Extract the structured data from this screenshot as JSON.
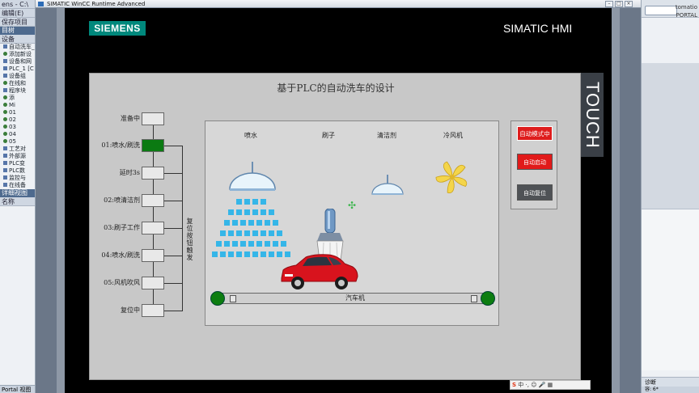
{
  "tia_left": {
    "strip1": "ens - C:\\",
    "strip2": "编辑(E)",
    "toolbar": "保存项目",
    "bar": "目树",
    "header": "设备",
    "tree": [
      "自动洗车_201",
      "添加新设",
      "设备和网",
      "PLC_1 [C",
      "设备组",
      "在线和",
      "程序块",
      "添",
      "Mi",
      "01",
      "02",
      "03",
      "04",
      "05",
      "工艺对",
      "外部源",
      "PLC变",
      "PLC数",
      "监控与",
      "在线备"
    ],
    "detail": "详细视图",
    "name_col": "名称",
    "bottom": "Portal 视图"
  },
  "tia_right": {
    "top1": "tomatio",
    "top2": "PORTAL",
    "diag": "诊断",
    "foot": "容: 6*"
  },
  "runtime": {
    "title": "SIMATIC WinCC Runtime Advanced",
    "brand": "SIEMENS",
    "hmi_label": "SIMATIC HMI",
    "touch": "TOUCH",
    "screen_title": "基于PLC的自动洗车的设计",
    "steps": [
      {
        "label": "准备中",
        "active": false
      },
      {
        "label": "01:喷水/刷洗",
        "active": true
      },
      {
        "label": "延时3s",
        "active": false
      },
      {
        "label": "02:喷清洁剂",
        "active": false
      },
      {
        "label": "03:刷子工作",
        "active": false
      },
      {
        "label": "04:喷水/刷洗",
        "active": false
      },
      {
        "label": "05:风机吹风",
        "active": false
      },
      {
        "label": "复位中",
        "active": false
      }
    ],
    "loop_label": "复位按钮触发",
    "process": {
      "spray": "喷水",
      "brush": "刷子",
      "detergent": "清洁剂",
      "fan": "冷风机",
      "belt": "汽车机"
    },
    "controls": {
      "mode": "自动模式中",
      "start": "自动启动",
      "reset": "自动复位"
    },
    "tray": "中 ·,"
  },
  "colors": {
    "siemens": "#00887c",
    "active_step": "#0b7a12",
    "button_red": "#e11a1a",
    "button_grey": "#4f5256",
    "water": "#35b6e8"
  }
}
